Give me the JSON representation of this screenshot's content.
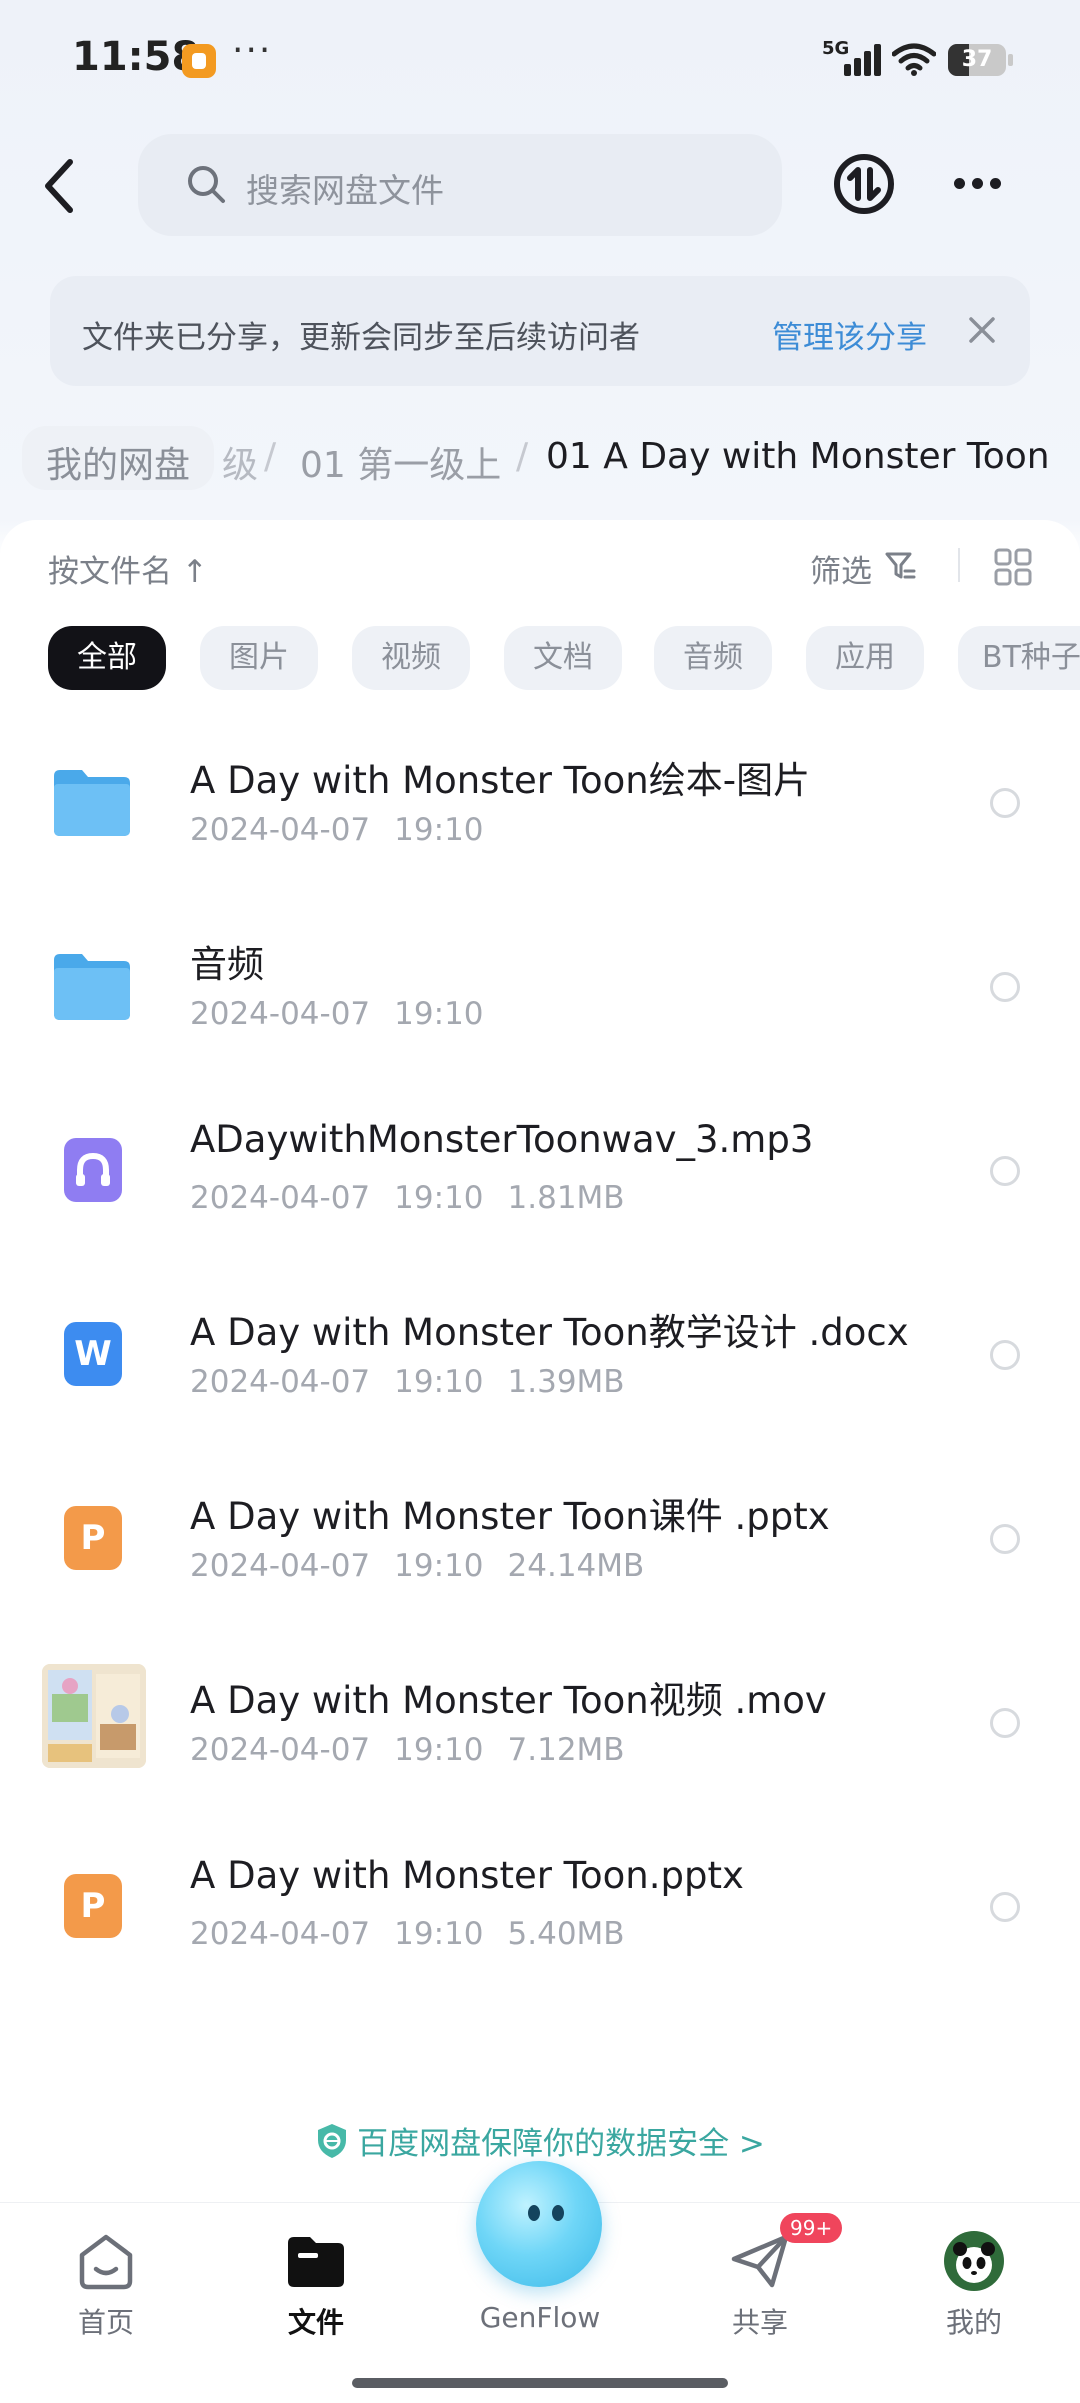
{
  "status_bar": {
    "time": "11:58",
    "dots": "···",
    "network": "5G",
    "battery": "37",
    "battery_level": 0.37
  },
  "header": {
    "search_placeholder": "搜索网盘文件"
  },
  "share_banner": {
    "text": "文件夹已分享，更新会同步至后续访问者",
    "link": "管理该分享"
  },
  "breadcrumb": {
    "root": "我的网盘",
    "faded": "级",
    "separator": "/",
    "middle": "01 第一级上",
    "current": "01 A Day with Monster Toon"
  },
  "toolbar": {
    "sort": "按文件名 ↑",
    "filter": "筛选"
  },
  "chips": [
    "全部",
    "图片",
    "视频",
    "文档",
    "音频",
    "应用",
    "BT种子"
  ],
  "files": [
    {
      "name": "A Day with Monster Toon绘本-图片",
      "date": "2024-04-07",
      "time": "19:10",
      "size": "",
      "icon": "folder-icon"
    },
    {
      "name": "音频",
      "date": "2024-04-07",
      "time": "19:10",
      "size": "",
      "icon": "folder-icon"
    },
    {
      "name": "ADaywithMonsterToonwav_3.mp3",
      "date": "2024-04-07",
      "time": "19:10",
      "size": "1.81MB",
      "icon": "audio-file-icon"
    },
    {
      "name": "A Day with Monster Toon教学设计 .docx",
      "date": "2024-04-07",
      "time": "19:10",
      "size": "1.39MB",
      "icon": "word-file-icon"
    },
    {
      "name": "A Day with Monster Toon课件 .pptx",
      "date": "2024-04-07",
      "time": "19:10",
      "size": "24.14MB",
      "icon": "ppt-file-icon"
    },
    {
      "name": "A Day with Monster Toon视频 .mov",
      "date": "2024-04-07",
      "time": "19:10",
      "size": "7.12MB",
      "icon": "video-thumbnail"
    },
    {
      "name": "A Day with Monster Toon.pptx",
      "date": "2024-04-07",
      "time": "19:10",
      "size": "5.40MB",
      "icon": "ppt-file-icon"
    }
  ],
  "file_icon_letters": {
    "word": "W",
    "ppt": "P"
  },
  "security_hint": "百度网盘保障你的数据安全 >",
  "bottom_nav": [
    {
      "label": "首页",
      "icon": "home-icon"
    },
    {
      "label": "文件",
      "icon": "folder-nav-icon"
    },
    {
      "label": "GenFlow",
      "icon": "genflow-orb"
    },
    {
      "label": "共享",
      "icon": "share-plane-icon"
    },
    {
      "label": "我的",
      "icon": "panda-avatar-icon"
    }
  ],
  "share_badge": "99+",
  "colors": {
    "accent": "#3d8cd6",
    "active_chip": "#121217",
    "folder": "#5cb8f2",
    "badge": "#f0455c",
    "security": "#3aa7a0"
  }
}
